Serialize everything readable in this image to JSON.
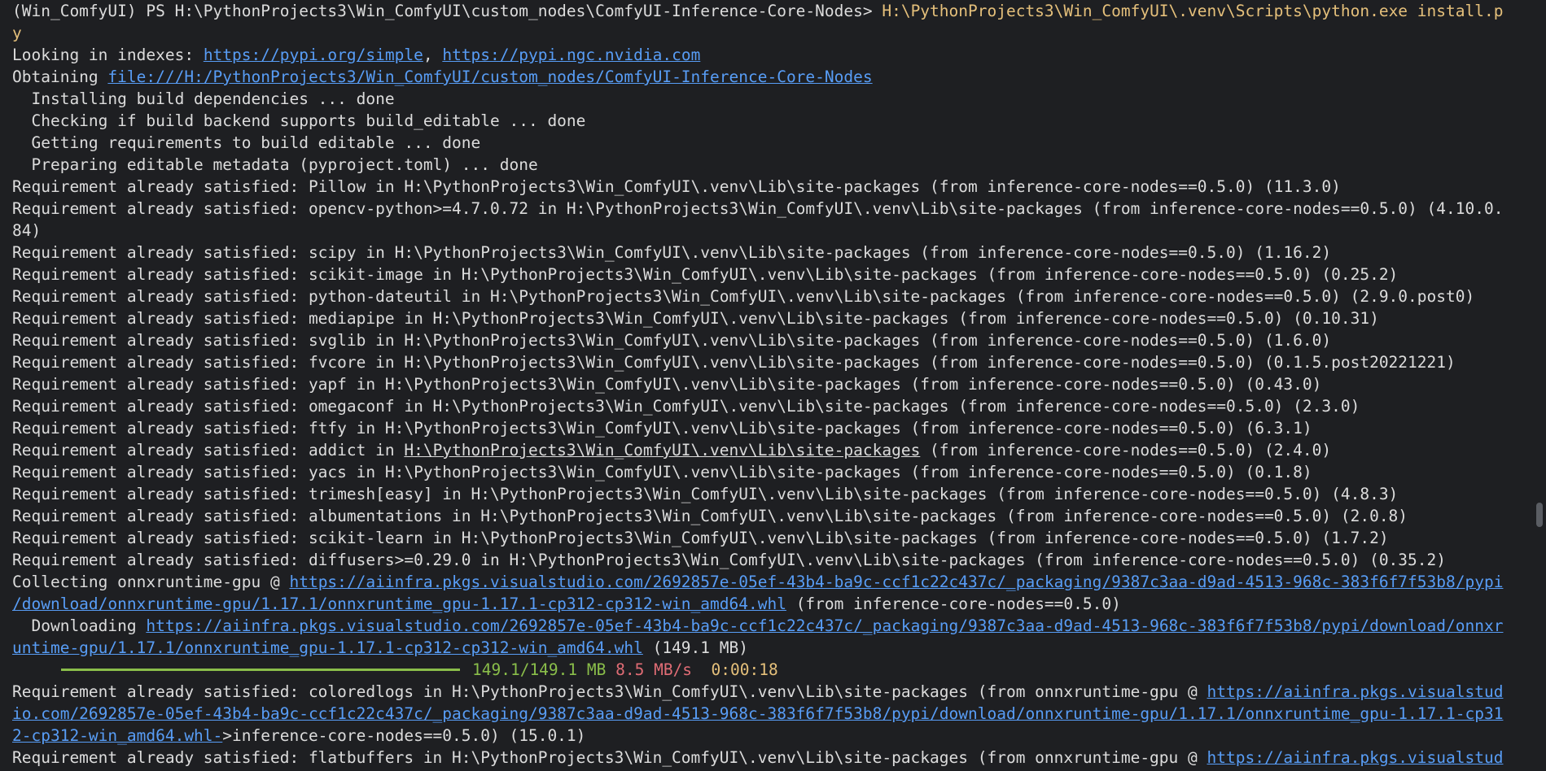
{
  "terminal": {
    "lines": [
      {
        "segs": [
          {
            "t": "(Win_ComfyUI) PS H:\\PythonProjects3\\Win_ComfyUI\\custom_nodes\\ComfyUI-Inference-Core-Nodes> "
          },
          {
            "t": "H:\\PythonProjects3\\Win_ComfyUI\\.venv\\Scripts\\python.exe install.p",
            "c": "cmd"
          }
        ]
      },
      {
        "segs": [
          {
            "t": "y",
            "c": "cmd"
          }
        ]
      },
      {
        "segs": [
          {
            "t": "Looking in indexes: "
          },
          {
            "t": "https://pypi.org/simple",
            "c": "link"
          },
          {
            "t": ", "
          },
          {
            "t": "https://pypi.ngc.nvidia.com",
            "c": "link"
          }
        ]
      },
      {
        "segs": [
          {
            "t": "Obtaining "
          },
          {
            "t": "file:///H:/PythonProjects3/Win_ComfyUI/custom_nodes/ComfyUI-Inference-Core-Nodes",
            "c": "link"
          }
        ]
      },
      {
        "segs": [
          {
            "t": "  Installing build dependencies ... done"
          }
        ]
      },
      {
        "segs": [
          {
            "t": "  Checking if build backend supports build_editable ... done"
          }
        ]
      },
      {
        "segs": [
          {
            "t": "  Getting requirements to build editable ... done"
          }
        ]
      },
      {
        "segs": [
          {
            "t": "  Preparing editable metadata (pyproject.toml) ... done"
          }
        ]
      },
      {
        "segs": [
          {
            "t": "Requirement already satisfied: Pillow in H:\\PythonProjects3\\Win_ComfyUI\\.venv\\Lib\\site-packages (from inference-core-nodes==0.5.0) (11.3.0)"
          }
        ]
      },
      {
        "segs": [
          {
            "t": "Requirement already satisfied: opencv-python>=4.7.0.72 in H:\\PythonProjects3\\Win_ComfyUI\\.venv\\Lib\\site-packages (from inference-core-nodes==0.5.0) (4.10.0."
          }
        ]
      },
      {
        "segs": [
          {
            "t": "84)"
          }
        ]
      },
      {
        "segs": [
          {
            "t": "Requirement already satisfied: scipy in H:\\PythonProjects3\\Win_ComfyUI\\.venv\\Lib\\site-packages (from inference-core-nodes==0.5.0) (1.16.2)"
          }
        ]
      },
      {
        "segs": [
          {
            "t": "Requirement already satisfied: scikit-image in H:\\PythonProjects3\\Win_ComfyUI\\.venv\\Lib\\site-packages (from inference-core-nodes==0.5.0) (0.25.2)"
          }
        ]
      },
      {
        "segs": [
          {
            "t": "Requirement already satisfied: python-dateutil in H:\\PythonProjects3\\Win_ComfyUI\\.venv\\Lib\\site-packages (from inference-core-nodes==0.5.0) (2.9.0.post0)"
          }
        ]
      },
      {
        "segs": [
          {
            "t": "Requirement already satisfied: mediapipe in H:\\PythonProjects3\\Win_ComfyUI\\.venv\\Lib\\site-packages (from inference-core-nodes==0.5.0) (0.10.31)"
          }
        ]
      },
      {
        "segs": [
          {
            "t": "Requirement already satisfied: svglib in H:\\PythonProjects3\\Win_ComfyUI\\.venv\\Lib\\site-packages (from inference-core-nodes==0.5.0) (1.6.0)"
          }
        ]
      },
      {
        "segs": [
          {
            "t": "Requirement already satisfied: fvcore in H:\\PythonProjects3\\Win_ComfyUI\\.venv\\Lib\\site-packages (from inference-core-nodes==0.5.0) (0.1.5.post20221221)"
          }
        ]
      },
      {
        "segs": [
          {
            "t": "Requirement already satisfied: yapf in H:\\PythonProjects3\\Win_ComfyUI\\.venv\\Lib\\site-packages (from inference-core-nodes==0.5.0) (0.43.0)"
          }
        ]
      },
      {
        "segs": [
          {
            "t": "Requirement already satisfied: omegaconf in H:\\PythonProjects3\\Win_ComfyUI\\.venv\\Lib\\site-packages (from inference-core-nodes==0.5.0) (2.3.0)"
          }
        ]
      },
      {
        "segs": [
          {
            "t": "Requirement already satisfied: ftfy in H:\\PythonProjects3\\Win_ComfyUI\\.venv\\Lib\\site-packages (from inference-core-nodes==0.5.0) (6.3.1)"
          }
        ]
      },
      {
        "segs": [
          {
            "t": "Requirement already satisfied: addict in "
          },
          {
            "t": "H:\\PythonProjects3\\Win_ComfyUI\\.venv\\Lib\\site-packages",
            "c": "uline"
          },
          {
            "t": " (from inference-core-nodes==0.5.0) (2.4.0)"
          }
        ]
      },
      {
        "segs": [
          {
            "t": "Requirement already satisfied: yacs in H:\\PythonProjects3\\Win_ComfyUI\\.venv\\Lib\\site-packages (from inference-core-nodes==0.5.0) (0.1.8)"
          }
        ]
      },
      {
        "segs": [
          {
            "t": "Requirement already satisfied: trimesh[easy] in H:\\PythonProjects3\\Win_ComfyUI\\.venv\\Lib\\site-packages (from inference-core-nodes==0.5.0) (4.8.3)"
          }
        ]
      },
      {
        "segs": [
          {
            "t": "Requirement already satisfied: albumentations in H:\\PythonProjects3\\Win_ComfyUI\\.venv\\Lib\\site-packages (from inference-core-nodes==0.5.0) (2.0.8)"
          }
        ]
      },
      {
        "segs": [
          {
            "t": "Requirement already satisfied: scikit-learn in H:\\PythonProjects3\\Win_ComfyUI\\.venv\\Lib\\site-packages (from inference-core-nodes==0.5.0) (1.7.2)"
          }
        ]
      },
      {
        "segs": [
          {
            "t": "Requirement already satisfied: diffusers>=0.29.0 in H:\\PythonProjects3\\Win_ComfyUI\\.venv\\Lib\\site-packages (from inference-core-nodes==0.5.0) (0.35.2)"
          }
        ]
      },
      {
        "segs": [
          {
            "t": "Collecting onnxruntime-gpu @ "
          },
          {
            "t": "https://aiinfra.pkgs.visualstudio.com/2692857e-05ef-43b4-ba9c-ccf1c22c437c/_packaging/9387c3aa-d9ad-4513-968c-383f6f7f53b8/pypi",
            "c": "link"
          }
        ]
      },
      {
        "segs": [
          {
            "t": "/download/onnxruntime-gpu/1.17.1/onnxruntime_gpu-1.17.1-cp312-cp312-win_amd64.whl",
            "c": "link"
          },
          {
            "t": " (from inference-core-nodes==0.5.0)"
          }
        ]
      },
      {
        "segs": [
          {
            "t": "  Downloading "
          },
          {
            "t": "https://aiinfra.pkgs.visualstudio.com/2692857e-05ef-43b4-ba9c-ccf1c22c437c/_packaging/9387c3aa-d9ad-4513-968c-383f6f7f53b8/pypi/download/onnxr",
            "c": "link"
          }
        ]
      },
      {
        "segs": [
          {
            "t": "untime-gpu/1.17.1/onnxruntime_gpu-1.17.1-cp312-cp312-win_amd64.whl",
            "c": "link"
          },
          {
            "t": " (149.1 MB)"
          }
        ]
      },
      {
        "progress": true,
        "fraction": 1.0,
        "size": "149.1/149.1 MB",
        "speed": "8.5 MB/s",
        "eta": "0:00:18"
      },
      {
        "segs": [
          {
            "t": "Requirement already satisfied: coloredlogs in H:\\PythonProjects3\\Win_ComfyUI\\.venv\\Lib\\site-packages (from onnxruntime-gpu @ "
          },
          {
            "t": "https://aiinfra.pkgs.visualstud",
            "c": "link"
          }
        ]
      },
      {
        "segs": [
          {
            "t": "io.com/2692857e-05ef-43b4-ba9c-ccf1c22c437c/_packaging/9387c3aa-d9ad-4513-968c-383f6f7f53b8/pypi/download/onnxruntime-gpu/1.17.1/onnxruntime_gpu-1.17.1-cp31",
            "c": "link"
          }
        ]
      },
      {
        "segs": [
          {
            "t": "2-cp312-win_amd64.whl-",
            "c": "link"
          },
          {
            "t": ">inference-core-nodes==0.5.0) (15.0.1)"
          }
        ]
      },
      {
        "segs": [
          {
            "t": "Requirement already satisfied: flatbuffers in H:\\PythonProjects3\\Win_ComfyUI\\.venv\\Lib\\site-packages (from onnxruntime-gpu @ "
          },
          {
            "t": "https://aiinfra.pkgs.visualstud",
            "c": "link"
          }
        ]
      }
    ]
  },
  "colors": {
    "background": "#1e1f22",
    "text": "#dcdcdc",
    "command": "#e5c07b",
    "link": "#589df6",
    "progress": "#8abe4a",
    "speed": "#e06c75"
  }
}
